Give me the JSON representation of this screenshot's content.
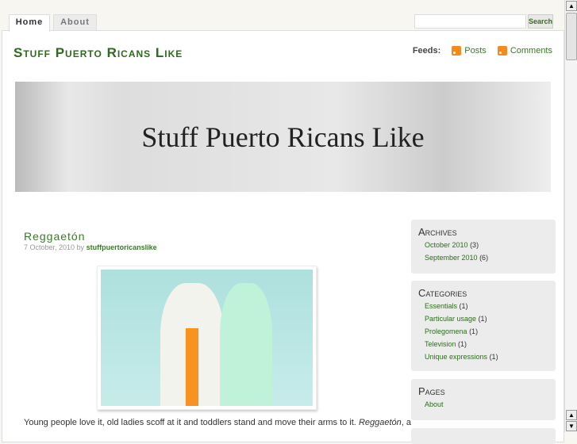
{
  "nav": {
    "tabs": [
      "Home",
      "About"
    ],
    "search_placeholder": "",
    "search_button": "Search"
  },
  "header": {
    "site_title": "Stuff Puerto Ricans Like",
    "feeds_label": "Feeds:",
    "feeds": [
      "Posts",
      "Comments"
    ],
    "banner_text": "Stuff Puerto Ricans Like"
  },
  "post": {
    "title": "Reggaetón",
    "date": "7 October, 2010 by",
    "author": "stuffpuertoricanslike",
    "body_start": "Young people love it, old ladies scoff at it and toddlers stand and move their arms to it.",
    "body_em": "Reggaetón",
    "body_end": ", a"
  },
  "sidebar": {
    "archives": {
      "title": "Archives",
      "items": [
        {
          "label": "October 2010",
          "count": "(3)"
        },
        {
          "label": "September 2010",
          "count": "(6)"
        }
      ]
    },
    "categories": {
      "title": "Categories",
      "items": [
        {
          "label": "Essentials",
          "count": "(1)"
        },
        {
          "label": "Particular usage",
          "count": "(1)"
        },
        {
          "label": "Prolegomena",
          "count": "(1)"
        },
        {
          "label": "Television",
          "count": "(1)"
        },
        {
          "label": "Unique expressions",
          "count": "(1)"
        }
      ]
    },
    "pages": {
      "title": "Pages",
      "items": [
        {
          "label": "About"
        }
      ]
    }
  }
}
